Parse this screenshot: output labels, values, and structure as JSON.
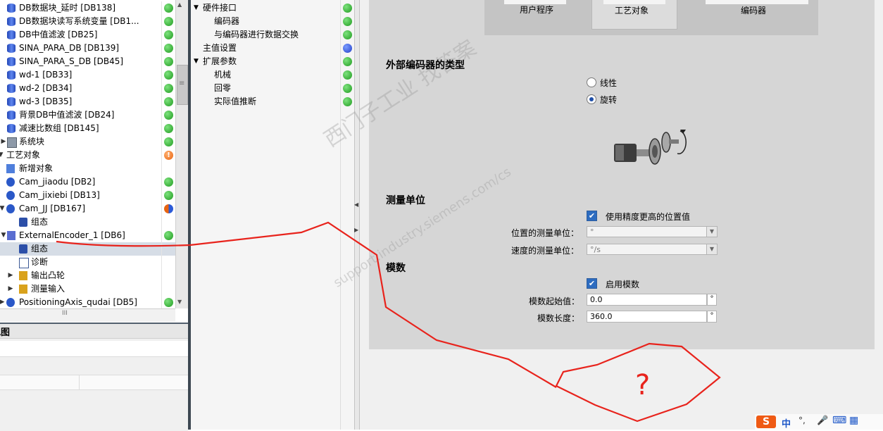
{
  "tree": {
    "rows": [
      {
        "label": "DB数据块_延时 [DB138]",
        "status": "green"
      },
      {
        "label": "DB数据块读写系统变量 [DB1...",
        "status": "green"
      },
      {
        "label": "DB中值滤波 [DB25]",
        "status": "green"
      },
      {
        "label": "SINA_PARA_DB [DB139]",
        "status": "green"
      },
      {
        "label": "SINA_PARA_S_DB [DB45]",
        "status": "green"
      },
      {
        "label": "wd-1 [DB33]",
        "status": "green"
      },
      {
        "label": "wd-2 [DB34]",
        "status": "green"
      },
      {
        "label": "wd-3 [DB35]",
        "status": "green"
      },
      {
        "label": "背景DB中值滤波 [DB24]",
        "status": "green"
      },
      {
        "label": "减速比数组 [DB145]",
        "status": "green"
      },
      {
        "label": "系统块",
        "status": "green"
      },
      {
        "label": "工艺对象",
        "status": "orange"
      },
      {
        "label": "新增对象",
        "status": ""
      },
      {
        "label": "Cam_jiaodu [DB2]",
        "status": "green"
      },
      {
        "label": "Cam_jixiebi [DB13]",
        "status": "green"
      },
      {
        "label": "Cam_JJ [DB167]",
        "status": "mixed"
      },
      {
        "label": "组态",
        "status": ""
      },
      {
        "label": "ExternalEncoder_1 [DB6]",
        "status": "green"
      },
      {
        "label": "组态",
        "status": ""
      },
      {
        "label": "诊断",
        "status": ""
      },
      {
        "label": "输出凸轮",
        "status": ""
      },
      {
        "label": "测量输入",
        "status": ""
      },
      {
        "label": "PositioningAxis_qudai [DB5]",
        "status": "green"
      }
    ],
    "orange_mark": "!",
    "scroll_mark": "≡",
    "hscroll_mark": "III"
  },
  "lower_panel": {
    "title": "视图"
  },
  "nav": {
    "rows": [
      {
        "label": "硬件接口",
        "expand": "▼",
        "status": "green"
      },
      {
        "label": "编码器",
        "expand": "",
        "status": "green"
      },
      {
        "label": "与编码器进行数据交换",
        "expand": "",
        "status": "green"
      },
      {
        "label": "主值设置",
        "expand": "",
        "status": "blue"
      },
      {
        "label": "扩展参数",
        "expand": "▼",
        "status": "green"
      },
      {
        "label": "机械",
        "expand": "",
        "status": "green"
      },
      {
        "label": "回零",
        "expand": "",
        "status": "green"
      },
      {
        "label": "实际值推断",
        "expand": "",
        "status": "green"
      }
    ]
  },
  "device_bar": {
    "items": [
      "用户程序",
      "工艺对象",
      "编码器"
    ]
  },
  "encoder_type": {
    "heading": "外部编码器的类型",
    "options": [
      {
        "label": "线性",
        "checked": false
      },
      {
        "label": "旋转",
        "checked": true
      }
    ]
  },
  "measure_unit": {
    "heading": "测量单位",
    "high_precision_label": "使用精度更高的位置值",
    "high_precision_checked": true,
    "position_unit_label": "位置的测量单位：",
    "position_unit_value": "°",
    "velocity_unit_label": "速度的测量单位：",
    "velocity_unit_value": "°/s"
  },
  "modulo": {
    "heading": "模数",
    "enable_label": "启用模数",
    "enable_checked": true,
    "start_label": "模数起始值：",
    "start_value": "0.0",
    "start_unit": "°",
    "length_label": "模数长度：",
    "length_value": "360.0",
    "length_unit": "°"
  },
  "watermark": {
    "line1": "西门子工业  找答案",
    "line2": "support.industry.siemens.com/cs"
  },
  "annotation": {
    "text": "?",
    "color": "#e8231c"
  },
  "ime": {
    "logo": "S",
    "mode": "中",
    "punct": "°,",
    "mic": "🎤",
    "keyboard": "⌨",
    "grid": "▦"
  },
  "colors": {
    "status_green": "#1e9a1e",
    "status_orange": "#e86410",
    "status_blue": "#2440c8",
    "annotation_red": "#e8231c"
  }
}
